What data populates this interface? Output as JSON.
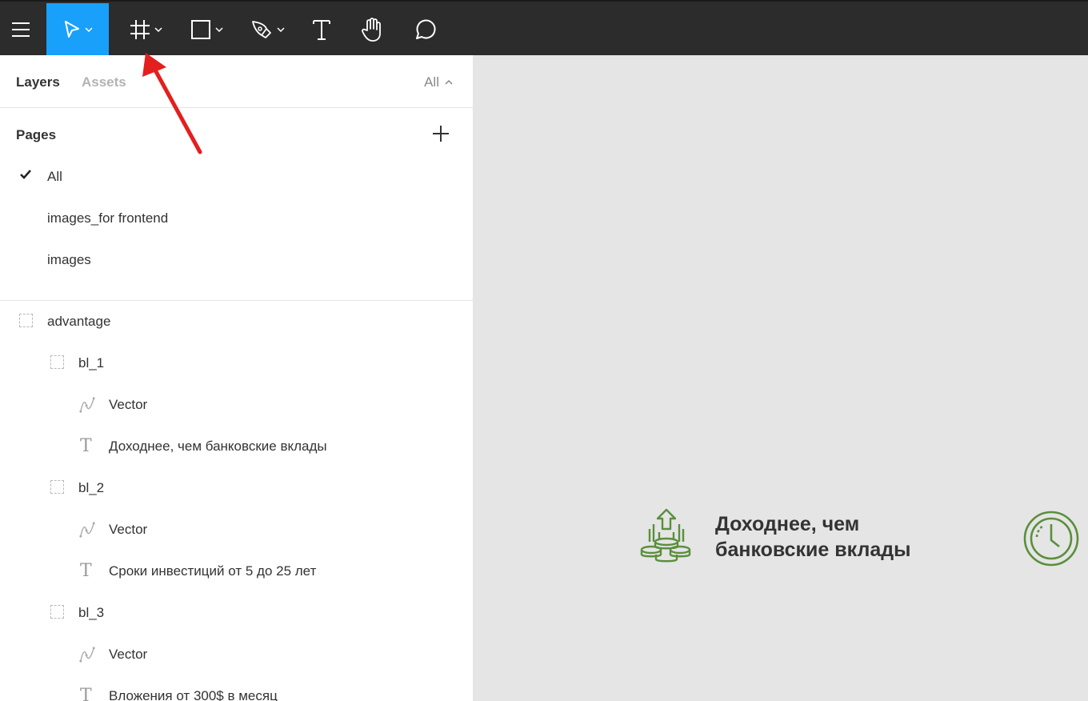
{
  "toolbar": {
    "tools": [
      "menu-icon",
      "move-tool",
      "frame-tool",
      "rectangle-tool",
      "pen-tool",
      "text-tool",
      "hand-tool",
      "comment-tool"
    ],
    "active_tool": "move-tool",
    "accent": "#18a0fb"
  },
  "panel": {
    "tab_layers": "Layers",
    "tab_assets": "Assets",
    "filter_label": "All",
    "pages_title": "Pages",
    "pages": [
      {
        "label": "All",
        "selected": true
      },
      {
        "label": "images_for frontend",
        "selected": false
      },
      {
        "label": "images",
        "selected": false
      }
    ],
    "layers": [
      {
        "label": "advantage",
        "type": "frame"
      },
      {
        "label": "bl_1",
        "type": "frame"
      },
      {
        "label": "Vector",
        "type": "vector"
      },
      {
        "label": "Доходнее, чем банковские вклады",
        "type": "text"
      },
      {
        "label": "bl_2",
        "type": "frame"
      },
      {
        "label": "Vector",
        "type": "vector"
      },
      {
        "label": "Сроки инвестиций от 5 до 25 лет",
        "type": "text"
      },
      {
        "label": "bl_3",
        "type": "frame"
      },
      {
        "label": "Vector",
        "type": "vector"
      },
      {
        "label": "Вложения от 300$ в месяц",
        "type": "text"
      }
    ]
  },
  "canvas": {
    "advantage_line1": "Доходнее, чем",
    "advantage_line2": "банковские вклады",
    "icon_color": "#5a8f3c"
  }
}
